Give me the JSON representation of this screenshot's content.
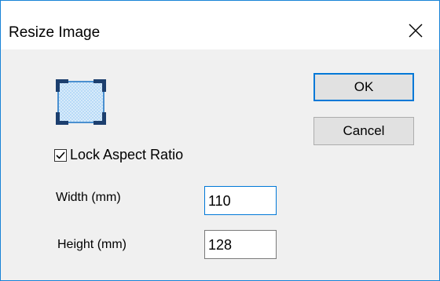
{
  "dialog": {
    "title": "Resize Image"
  },
  "icons": {
    "close": "close-icon",
    "image": "resize-image-icon",
    "check": "checkmark-icon"
  },
  "lock_aspect": {
    "label": "Lock Aspect Ratio",
    "checked": true
  },
  "fields": {
    "width": {
      "label": "Width  (mm)",
      "value": "110"
    },
    "height": {
      "label": "Height (mm)",
      "value": "128"
    }
  },
  "buttons": {
    "ok": "OK",
    "cancel": "Cancel"
  },
  "colors": {
    "accent": "#0078d7",
    "window_border": "#1883d7",
    "dialog_bg": "#f0f0f0",
    "button_bg": "#e1e1e1"
  }
}
